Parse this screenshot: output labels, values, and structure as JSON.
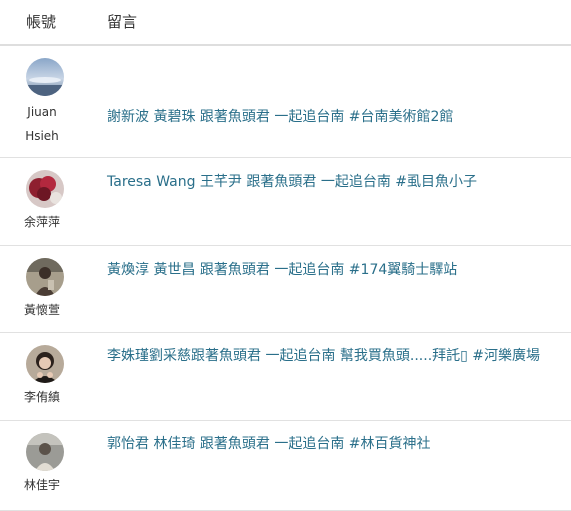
{
  "header": {
    "account_label": "帳號",
    "comment_label": "留言"
  },
  "rows": [
    {
      "name_line1": "Jiuan",
      "name_line2": "Hsieh",
      "avatar_icon": "sky-photo-avatar-icon",
      "comment": "謝新波 黃碧珠 跟著魚頭君 一起追台南 #台南美術館2館"
    },
    {
      "name": "余萍萍",
      "avatar_icon": "red-flower-avatar-icon",
      "comment": "Taresa Wang 王芊尹 跟著魚頭君 一起追台南 #虱目魚小子"
    },
    {
      "name": "黃懷萱",
      "avatar_icon": "person-outdoor-avatar-icon",
      "comment": "黃煥淳 黃世昌 跟著魚頭君 一起追台南 #174翼騎士驛站"
    },
    {
      "name": "李侑縝",
      "avatar_icon": "person-portrait-avatar-icon",
      "comment": "李姝瑾劉采慈跟著魚頭君 一起追台南 幫我買魚頭.....拜託▯ #河樂廣場"
    },
    {
      "name": "林佳宇",
      "avatar_icon": "person-gray-avatar-icon",
      "comment": "郭怡君 林佳琦 跟著魚頭君 一起追台南 #林百貨神社"
    }
  ],
  "colors": {
    "link": "#2a6f8a",
    "text": "#333333",
    "divider": "#e1e1e1"
  }
}
